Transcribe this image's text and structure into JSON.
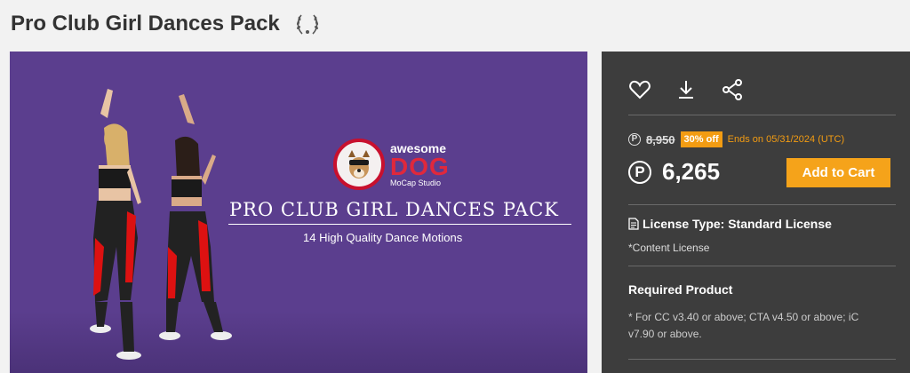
{
  "product": {
    "title": "Pro Club Girl Dances Pack",
    "badge_icon": "laurel-wreath-icon"
  },
  "banner": {
    "logo_awesome": "awesome",
    "logo_dog": "DOG",
    "logo_mocap": "MoCap Studio",
    "title": "PRO CLUB GIRL DANCES PACK",
    "subtitle": "14 High Quality Dance Motions",
    "background_color": "#5b3e8e"
  },
  "actions": {
    "icons": [
      "heart-icon",
      "download-icon",
      "share-icon"
    ]
  },
  "pricing": {
    "currency_symbol": "P",
    "original_price": "8,950",
    "discount_label": "30% off",
    "ends_text": "Ends on 05/31/2024 (UTC)",
    "price": "6,265",
    "add_to_cart_label": "Add to Cart",
    "accent_color": "#f5a31a"
  },
  "license": {
    "type_label": "License Type: Standard License",
    "content_license": "*Content License"
  },
  "required": {
    "title": "Required Product",
    "text": "* For CC v3.40 or above; CTA v4.50 or above; iC v7.90 or above."
  }
}
